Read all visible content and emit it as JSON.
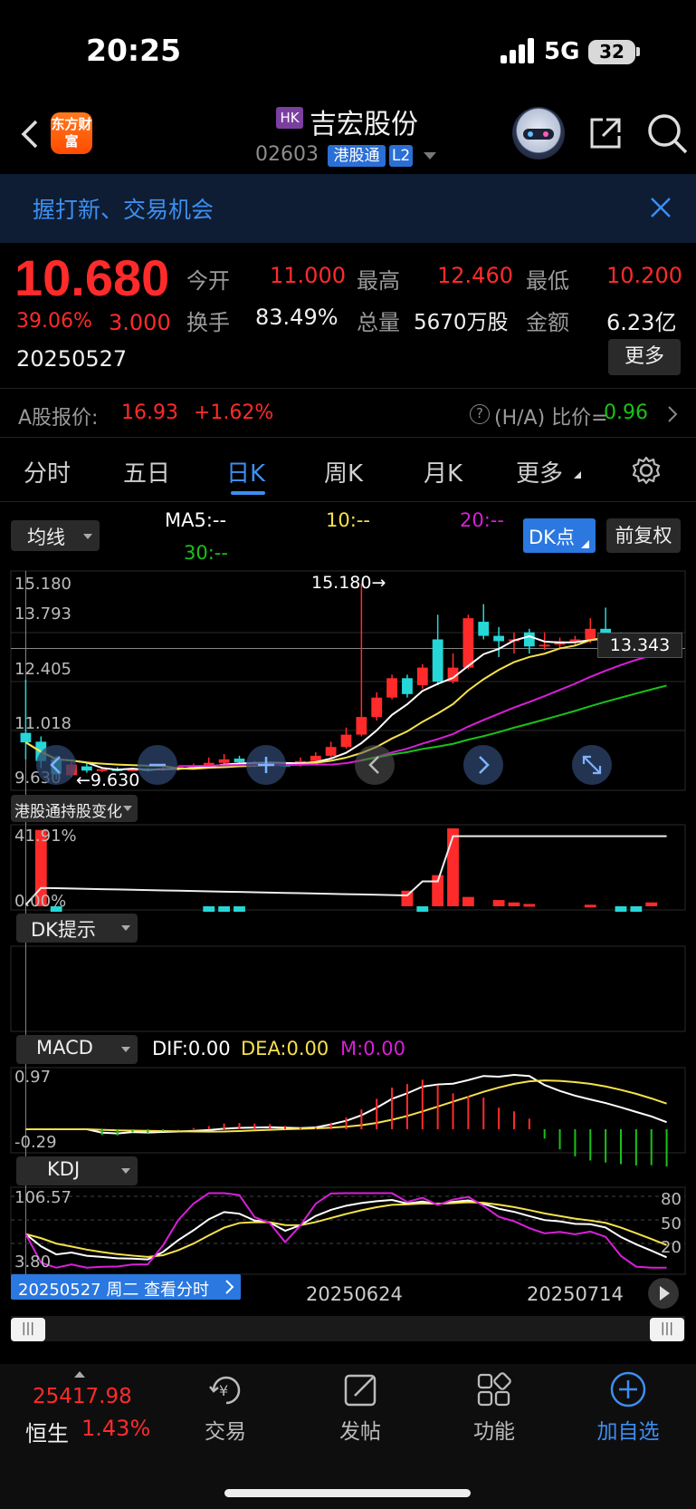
{
  "status_bar": {
    "time": "20:25",
    "network": "5G",
    "battery": "32"
  },
  "header": {
    "logo": "东方财富",
    "market_badge": "HK",
    "stock_name": "吉宏股份",
    "stock_code": "02603",
    "tag_connect": "港股通",
    "tag_level": "L2"
  },
  "banner": {
    "text": "握打新、交易机会"
  },
  "quote": {
    "price": "10.680",
    "change_pct": "39.06%",
    "change": "3.000",
    "date": "20250527",
    "open_label": "今开",
    "open": "11.000",
    "high_label": "最高",
    "high": "12.460",
    "low_label": "最低",
    "low": "10.200",
    "turnover_label": "换手",
    "turnover": "83.49%",
    "volume_label": "总量",
    "volume": "5670万股",
    "amount_label": "金额",
    "amount": "6.23亿",
    "more_label": "更多"
  },
  "a_share": {
    "label": "A股报价:",
    "price": "16.93",
    "change": "+1.62%",
    "ratio_label": "(H/A) 比价=",
    "ratio": "0.96"
  },
  "tabs": [
    "分时",
    "五日",
    "日K",
    "周K",
    "月K",
    "更多"
  ],
  "active_tab": "日K",
  "ma_bar": {
    "selector": "均线",
    "ma5": "MA5:--",
    "ma10": "10:--",
    "ma20": "20:--",
    "ma30": "30:--",
    "dk_button": "DK点",
    "adjust_button": "前复权"
  },
  "price_axis": [
    "15.180",
    "13.793",
    "12.405",
    "11.018",
    "9.630"
  ],
  "annotations": {
    "high_mark": "15.180",
    "low_mark": "9.630",
    "current_price": "13.343"
  },
  "hold_panel": {
    "selector": "港股通持股变化",
    "top": "41.91%",
    "bottom": "0.00%"
  },
  "dk_panel": {
    "selector": "DK提示"
  },
  "macd_panel": {
    "selector": "MACD",
    "dif": "DIF:0.00",
    "dea": "DEA:0.00",
    "m": "M:0.00",
    "top": "0.97",
    "bottom": "-0.29"
  },
  "kdj_panel": {
    "selector": "KDJ",
    "top": "106.57",
    "bottom": "3.80",
    "levels": [
      "80",
      "50",
      "20"
    ]
  },
  "x_axis": [
    "20250624",
    "20250714"
  ],
  "cursor_label": "20250527 周二 查看分时",
  "bottom_nav": {
    "index_value": "25417.98",
    "index_name": "恒生",
    "index_change": "1.43%",
    "items": [
      "交易",
      "发帖",
      "功能",
      "加自选"
    ]
  },
  "chart_data": [
    {
      "type": "candlestick",
      "title": "",
      "ylim": [
        9.63,
        15.18
      ],
      "candles": [
        {
          "o": 10.95,
          "c": 10.68,
          "h": 12.46,
          "l": 10.2,
          "dir": "down"
        },
        {
          "o": 10.7,
          "c": 10.15,
          "h": 10.85,
          "l": 9.95,
          "dir": "down"
        },
        {
          "o": 10.2,
          "c": 9.78,
          "h": 10.3,
          "l": 9.63,
          "dir": "down"
        },
        {
          "o": 9.75,
          "c": 10.05,
          "h": 10.15,
          "l": 9.7,
          "dir": "up"
        },
        {
          "o": 10.0,
          "c": 9.88,
          "h": 10.08,
          "l": 9.82,
          "dir": "down"
        },
        {
          "o": 9.88,
          "c": 9.92,
          "h": 9.98,
          "l": 9.84,
          "dir": "up"
        },
        {
          "o": 9.92,
          "c": 9.9,
          "h": 9.98,
          "l": 9.86,
          "dir": "down"
        },
        {
          "o": 9.9,
          "c": 9.92,
          "h": 9.96,
          "l": 9.86,
          "dir": "up"
        },
        {
          "o": 9.92,
          "c": 9.9,
          "h": 9.96,
          "l": 9.85,
          "dir": "down"
        },
        {
          "o": 9.9,
          "c": 9.95,
          "h": 10.0,
          "l": 9.86,
          "dir": "up"
        },
        {
          "o": 9.93,
          "c": 9.98,
          "h": 10.02,
          "l": 9.88,
          "dir": "up"
        },
        {
          "o": 9.98,
          "c": 10.02,
          "h": 10.08,
          "l": 9.94,
          "dir": "up"
        },
        {
          "o": 10.0,
          "c": 10.1,
          "h": 10.25,
          "l": 9.95,
          "dir": "up"
        },
        {
          "o": 10.1,
          "c": 10.2,
          "h": 10.35,
          "l": 10.05,
          "dir": "up"
        },
        {
          "o": 10.22,
          "c": 10.12,
          "h": 10.3,
          "l": 10.05,
          "dir": "down"
        },
        {
          "o": 10.1,
          "c": 10.05,
          "h": 10.15,
          "l": 9.98,
          "dir": "down"
        },
        {
          "o": 10.05,
          "c": 10.08,
          "h": 10.12,
          "l": 10.0,
          "dir": "up"
        },
        {
          "o": 10.05,
          "c": 10.03,
          "h": 10.1,
          "l": 9.98,
          "dir": "down"
        },
        {
          "o": 10.05,
          "c": 10.15,
          "h": 10.25,
          "l": 10.0,
          "dir": "up"
        },
        {
          "o": 10.15,
          "c": 10.3,
          "h": 10.4,
          "l": 10.1,
          "dir": "up"
        },
        {
          "o": 10.3,
          "c": 10.55,
          "h": 10.7,
          "l": 10.25,
          "dir": "up"
        },
        {
          "o": 10.55,
          "c": 10.9,
          "h": 11.1,
          "l": 10.5,
          "dir": "up"
        },
        {
          "o": 10.9,
          "c": 11.4,
          "h": 15.18,
          "l": 10.85,
          "dir": "up"
        },
        {
          "o": 11.4,
          "c": 11.95,
          "h": 12.1,
          "l": 11.3,
          "dir": "up"
        },
        {
          "o": 11.95,
          "c": 12.5,
          "h": 12.6,
          "l": 11.9,
          "dir": "up"
        },
        {
          "o": 12.5,
          "c": 12.05,
          "h": 12.6,
          "l": 11.95,
          "dir": "down"
        },
        {
          "o": 12.3,
          "c": 12.8,
          "h": 12.9,
          "l": 12.2,
          "dir": "up"
        },
        {
          "o": 13.6,
          "c": 12.4,
          "h": 14.3,
          "l": 12.3,
          "dir": "down"
        },
        {
          "o": 12.4,
          "c": 12.8,
          "h": 13.2,
          "l": 12.35,
          "dir": "up"
        },
        {
          "o": 12.8,
          "c": 14.2,
          "h": 14.3,
          "l": 12.75,
          "dir": "up"
        },
        {
          "o": 14.1,
          "c": 13.7,
          "h": 14.6,
          "l": 13.6,
          "dir": "down"
        },
        {
          "o": 13.7,
          "c": 13.55,
          "h": 13.95,
          "l": 13.1,
          "dir": "down"
        },
        {
          "o": 13.55,
          "c": 13.6,
          "h": 13.8,
          "l": 13.2,
          "dir": "up"
        },
        {
          "o": 13.8,
          "c": 13.4,
          "h": 13.9,
          "l": 13.2,
          "dir": "down"
        },
        {
          "o": 13.4,
          "c": 13.45,
          "h": 13.8,
          "l": 13.3,
          "dir": "up"
        },
        {
          "o": 13.45,
          "c": 13.55,
          "h": 13.65,
          "l": 13.35,
          "dir": "up"
        },
        {
          "o": 13.55,
          "c": 13.6,
          "h": 13.7,
          "l": 13.45,
          "dir": "up"
        },
        {
          "o": 13.6,
          "c": 13.9,
          "h": 14.2,
          "l": 13.5,
          "dir": "up"
        },
        {
          "o": 13.9,
          "c": 13.65,
          "h": 14.5,
          "l": 13.55,
          "dir": "down"
        },
        {
          "o": 13.65,
          "c": 13.5,
          "h": 13.8,
          "l": 13.45,
          "dir": "down"
        },
        {
          "o": 13.5,
          "c": 13.48,
          "h": 13.6,
          "l": 13.42,
          "dir": "down"
        },
        {
          "o": 13.48,
          "c": 13.45,
          "h": 13.52,
          "l": 13.4,
          "dir": "down"
        },
        {
          "o": 13.45,
          "c": 13.4,
          "h": 13.5,
          "l": 13.34,
          "dir": "down"
        }
      ]
    }
  ],
  "colors": {
    "up": "#ff2b2b",
    "down": "#26d7d7",
    "ma5": "#ffffff",
    "ma10": "#f5e14b",
    "ma20": "#d81fd8",
    "ma30": "#19c219",
    "accent": "#2a8cff"
  }
}
